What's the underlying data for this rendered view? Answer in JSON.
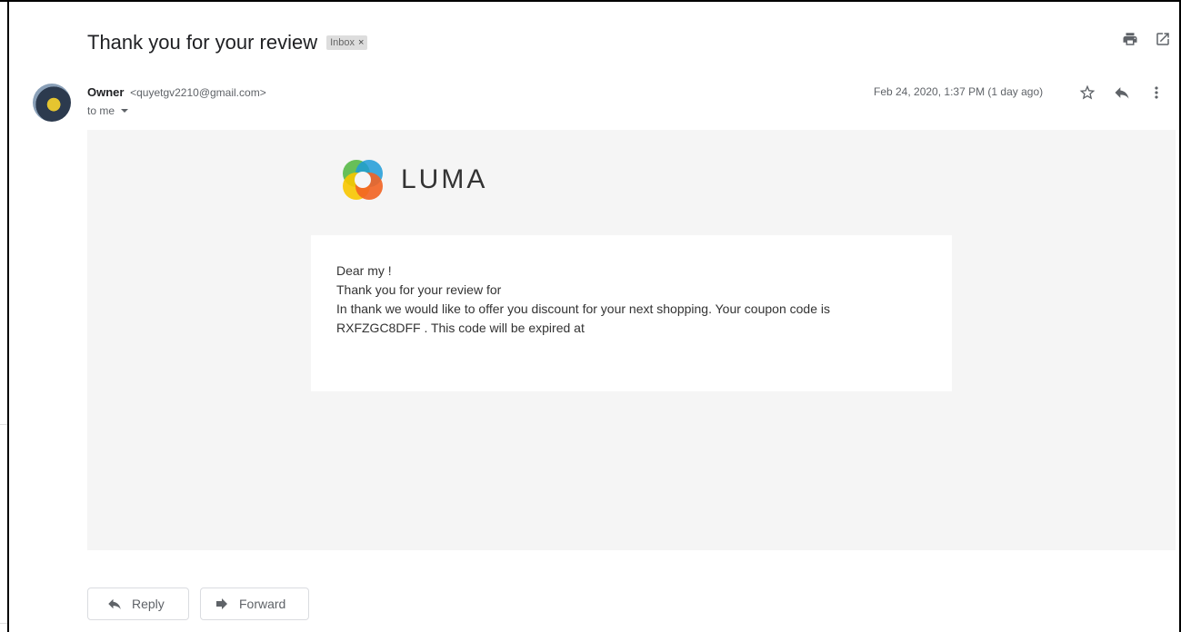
{
  "email": {
    "subject": "Thank you for your review",
    "label": "Inbox",
    "sender_name": "Owner",
    "sender_email": "<quyetgv2210@gmail.com>",
    "recipient": "to me",
    "date": "Feb 24, 2020, 1:37 PM (1 day ago)"
  },
  "icons": {
    "print": "print-icon",
    "open_new_window": "open-in-new-window-icon",
    "star": "star-icon",
    "reply": "reply-icon",
    "more": "more-vertical-icon"
  },
  "body": {
    "logo_text": "LUMA",
    "lines": [
      "Dear my !",
      "Thank you for your review for",
      "In thank we would like to offer you discount for your next shopping. Your coupon code is",
      "RXFZGC8DFF . This code will be expired at"
    ]
  },
  "actions": {
    "reply_label": "Reply",
    "forward_label": "Forward"
  }
}
